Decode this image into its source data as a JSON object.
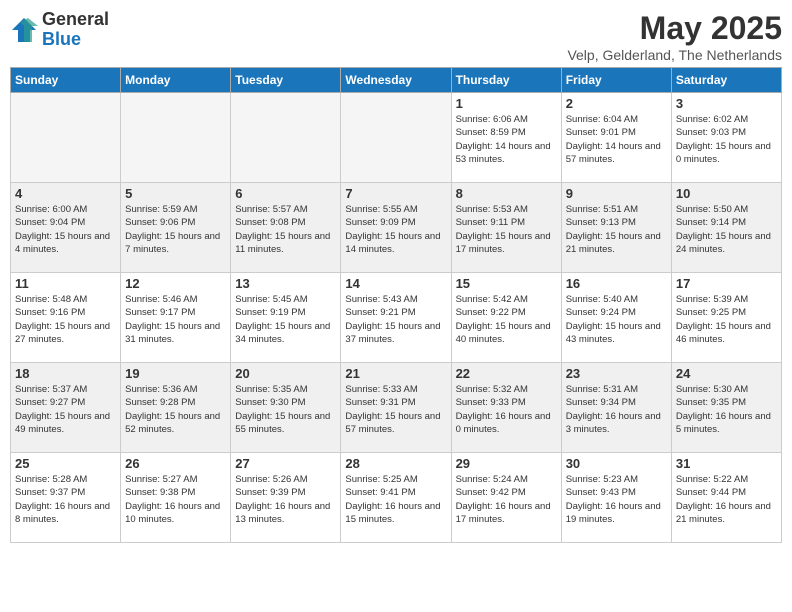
{
  "header": {
    "logo_general": "General",
    "logo_blue": "Blue",
    "month_title": "May 2025",
    "location": "Velp, Gelderland, The Netherlands"
  },
  "weekdays": [
    "Sunday",
    "Monday",
    "Tuesday",
    "Wednesday",
    "Thursday",
    "Friday",
    "Saturday"
  ],
  "weeks": [
    [
      {
        "day": "",
        "empty": true
      },
      {
        "day": "",
        "empty": true
      },
      {
        "day": "",
        "empty": true
      },
      {
        "day": "",
        "empty": true
      },
      {
        "day": "1",
        "sunrise": "6:06 AM",
        "sunset": "8:59 PM",
        "daylight": "14 hours and 53 minutes."
      },
      {
        "day": "2",
        "sunrise": "6:04 AM",
        "sunset": "9:01 PM",
        "daylight": "14 hours and 57 minutes."
      },
      {
        "day": "3",
        "sunrise": "6:02 AM",
        "sunset": "9:03 PM",
        "daylight": "15 hours and 0 minutes."
      }
    ],
    [
      {
        "day": "4",
        "sunrise": "6:00 AM",
        "sunset": "9:04 PM",
        "daylight": "15 hours and 4 minutes."
      },
      {
        "day": "5",
        "sunrise": "5:59 AM",
        "sunset": "9:06 PM",
        "daylight": "15 hours and 7 minutes."
      },
      {
        "day": "6",
        "sunrise": "5:57 AM",
        "sunset": "9:08 PM",
        "daylight": "15 hours and 11 minutes."
      },
      {
        "day": "7",
        "sunrise": "5:55 AM",
        "sunset": "9:09 PM",
        "daylight": "15 hours and 14 minutes."
      },
      {
        "day": "8",
        "sunrise": "5:53 AM",
        "sunset": "9:11 PM",
        "daylight": "15 hours and 17 minutes."
      },
      {
        "day": "9",
        "sunrise": "5:51 AM",
        "sunset": "9:13 PM",
        "daylight": "15 hours and 21 minutes."
      },
      {
        "day": "10",
        "sunrise": "5:50 AM",
        "sunset": "9:14 PM",
        "daylight": "15 hours and 24 minutes."
      }
    ],
    [
      {
        "day": "11",
        "sunrise": "5:48 AM",
        "sunset": "9:16 PM",
        "daylight": "15 hours and 27 minutes."
      },
      {
        "day": "12",
        "sunrise": "5:46 AM",
        "sunset": "9:17 PM",
        "daylight": "15 hours and 31 minutes."
      },
      {
        "day": "13",
        "sunrise": "5:45 AM",
        "sunset": "9:19 PM",
        "daylight": "15 hours and 34 minutes."
      },
      {
        "day": "14",
        "sunrise": "5:43 AM",
        "sunset": "9:21 PM",
        "daylight": "15 hours and 37 minutes."
      },
      {
        "day": "15",
        "sunrise": "5:42 AM",
        "sunset": "9:22 PM",
        "daylight": "15 hours and 40 minutes."
      },
      {
        "day": "16",
        "sunrise": "5:40 AM",
        "sunset": "9:24 PM",
        "daylight": "15 hours and 43 minutes."
      },
      {
        "day": "17",
        "sunrise": "5:39 AM",
        "sunset": "9:25 PM",
        "daylight": "15 hours and 46 minutes."
      }
    ],
    [
      {
        "day": "18",
        "sunrise": "5:37 AM",
        "sunset": "9:27 PM",
        "daylight": "15 hours and 49 minutes."
      },
      {
        "day": "19",
        "sunrise": "5:36 AM",
        "sunset": "9:28 PM",
        "daylight": "15 hours and 52 minutes."
      },
      {
        "day": "20",
        "sunrise": "5:35 AM",
        "sunset": "9:30 PM",
        "daylight": "15 hours and 55 minutes."
      },
      {
        "day": "21",
        "sunrise": "5:33 AM",
        "sunset": "9:31 PM",
        "daylight": "15 hours and 57 minutes."
      },
      {
        "day": "22",
        "sunrise": "5:32 AM",
        "sunset": "9:33 PM",
        "daylight": "16 hours and 0 minutes."
      },
      {
        "day": "23",
        "sunrise": "5:31 AM",
        "sunset": "9:34 PM",
        "daylight": "16 hours and 3 minutes."
      },
      {
        "day": "24",
        "sunrise": "5:30 AM",
        "sunset": "9:35 PM",
        "daylight": "16 hours and 5 minutes."
      }
    ],
    [
      {
        "day": "25",
        "sunrise": "5:28 AM",
        "sunset": "9:37 PM",
        "daylight": "16 hours and 8 minutes."
      },
      {
        "day": "26",
        "sunrise": "5:27 AM",
        "sunset": "9:38 PM",
        "daylight": "16 hours and 10 minutes."
      },
      {
        "day": "27",
        "sunrise": "5:26 AM",
        "sunset": "9:39 PM",
        "daylight": "16 hours and 13 minutes."
      },
      {
        "day": "28",
        "sunrise": "5:25 AM",
        "sunset": "9:41 PM",
        "daylight": "16 hours and 15 minutes."
      },
      {
        "day": "29",
        "sunrise": "5:24 AM",
        "sunset": "9:42 PM",
        "daylight": "16 hours and 17 minutes."
      },
      {
        "day": "30",
        "sunrise": "5:23 AM",
        "sunset": "9:43 PM",
        "daylight": "16 hours and 19 minutes."
      },
      {
        "day": "31",
        "sunrise": "5:22 AM",
        "sunset": "9:44 PM",
        "daylight": "16 hours and 21 minutes."
      }
    ]
  ]
}
